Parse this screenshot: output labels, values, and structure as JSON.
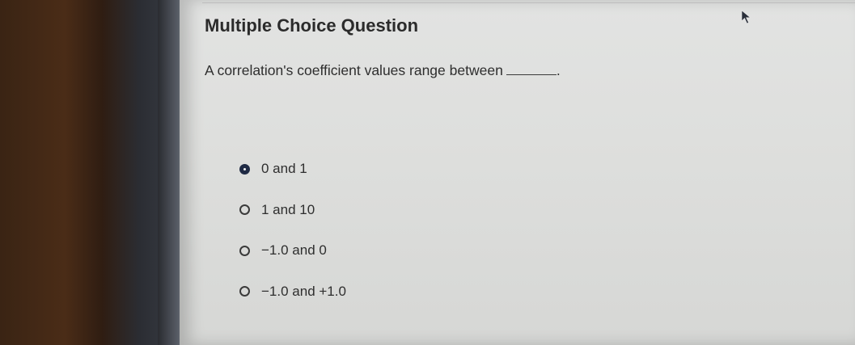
{
  "question": {
    "heading": "Multiple Choice Question",
    "prompt": "A correlation's coefficient values range between",
    "trailing": "."
  },
  "options": [
    {
      "label": "0 and 1",
      "selected": true
    },
    {
      "label": "1 and 10",
      "selected": false
    },
    {
      "label": "−1.0 and 0",
      "selected": false
    },
    {
      "label": "−1.0 and +1.0",
      "selected": false
    }
  ],
  "icons": {
    "cursor": "mouse-pointer-icon"
  },
  "colors": {
    "selected_radio": "#1f2a44",
    "text": "#2e2e2e"
  }
}
